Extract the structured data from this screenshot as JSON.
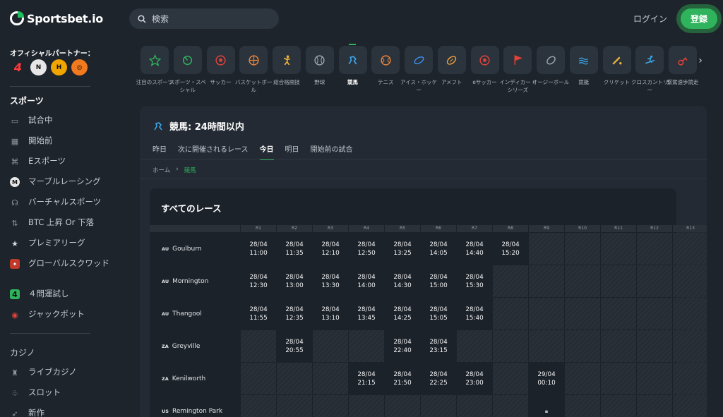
{
  "header": {
    "logo_text": "Sportsbet.io",
    "search_placeholder": "検索",
    "login": "ログイン",
    "register": "登録"
  },
  "sidebar": {
    "partner_label": "オフィシャルパートナー：",
    "sports_title": "スポーツ",
    "items": [
      {
        "label": "試合中",
        "icon": "monitor-icon"
      },
      {
        "label": "開始前",
        "icon": "calendar-icon"
      },
      {
        "label": "Eスポーツ",
        "icon": "gamepad-icon"
      },
      {
        "label": "マーブルレーシング",
        "icon": "marble-icon"
      },
      {
        "label": "バーチャルスポーツ",
        "icon": "headset-icon"
      },
      {
        "label": "BTC 上昇 Or 下落",
        "icon": "updown-icon"
      },
      {
        "label": "プレミアリーグ",
        "icon": "premier-icon"
      },
      {
        "label": "グローバルスクワッド",
        "icon": "squad-icon"
      },
      {
        "label": "４問運試し",
        "icon": "four-icon"
      },
      {
        "label": "ジャックポット",
        "icon": "jackpot-icon"
      }
    ],
    "casino_title": "カジノ",
    "casino_items": [
      {
        "label": "ライブカジノ",
        "icon": "dealer-icon"
      },
      {
        "label": "スロット",
        "icon": "slot-icon"
      },
      {
        "label": "新作",
        "icon": "rocket-icon"
      }
    ]
  },
  "sports": [
    {
      "label": "注目のスポーツ",
      "icon": "star-icon",
      "color": "#2fb35c"
    },
    {
      "label": "スポーツ・スペシャル",
      "icon": "special-icon",
      "color": "#2fb35c"
    },
    {
      "label": "サッカー",
      "icon": "soccer-icon",
      "color": "#e0423a"
    },
    {
      "label": "バスケットボール",
      "icon": "basketball-icon",
      "color": "#e9833a"
    },
    {
      "label": "総合格闘技",
      "icon": "mma-icon",
      "color": "#e9b23a"
    },
    {
      "label": "野球",
      "icon": "baseball-icon",
      "color": "#9aa2aa"
    },
    {
      "label": "競馬",
      "icon": "horse-icon",
      "color": "#3aa6e9",
      "active": true
    },
    {
      "label": "テニス",
      "icon": "tennis-icon",
      "color": "#e9833a"
    },
    {
      "label": "アイス・ホッケー",
      "icon": "hockey-icon",
      "color": "#3a8ee9"
    },
    {
      "label": "アメフト",
      "icon": "football-icon",
      "color": "#e9a03a"
    },
    {
      "label": "eサッカー",
      "icon": "esoccer-icon",
      "color": "#e0423a"
    },
    {
      "label": "インディカー・シリーズ",
      "icon": "flag-icon",
      "color": "#e0423a"
    },
    {
      "label": "オージーボール",
      "icon": "aussie-icon",
      "color": "#9aa2aa"
    },
    {
      "label": "競艇",
      "icon": "boat-icon",
      "color": "#3aa6e9"
    },
    {
      "label": "クリケット",
      "icon": "cricket-icon",
      "color": "#e9b23a"
    },
    {
      "label": "クロスカントリー",
      "icon": "ski-icon",
      "color": "#3aa6e9"
    },
    {
      "label": "繋駕速歩競走",
      "icon": "harness-icon",
      "color": "#e0423a"
    }
  ],
  "panel": {
    "title": "競馬: 24時間以内",
    "tabs": [
      "昨日",
      "次に開催されるレース",
      "今日",
      "明日",
      "開始前の試合"
    ],
    "active_tab": 2,
    "breadcrumb_home": "ホーム",
    "breadcrumb_current": "競馬",
    "races_title": "すべてのレース"
  },
  "race_grid": {
    "columns": [
      "R1",
      "R2",
      "R3",
      "R4",
      "R5",
      "R6",
      "R7",
      "R8",
      "R9",
      "R10",
      "R11",
      "R12",
      "R13"
    ],
    "rows": [
      {
        "cc": "AU",
        "name": "Goulburn",
        "cells": [
          [
            "28/04",
            "11:00"
          ],
          [
            "28/04",
            "11:35"
          ],
          [
            "28/04",
            "12:10"
          ],
          [
            "28/04",
            "12:50"
          ],
          [
            "28/04",
            "13:25"
          ],
          [
            "28/04",
            "14:05"
          ],
          [
            "28/04",
            "14:40"
          ],
          [
            "28/04",
            "15:20"
          ],
          null,
          null,
          null,
          null,
          null
        ]
      },
      {
        "cc": "AU",
        "name": "Mornington",
        "cells": [
          [
            "28/04",
            "12:30"
          ],
          [
            "28/04",
            "13:00"
          ],
          [
            "28/04",
            "13:30"
          ],
          [
            "28/04",
            "14:00"
          ],
          [
            "28/04",
            "14:30"
          ],
          [
            "28/04",
            "15:00"
          ],
          [
            "28/04",
            "15:30"
          ],
          null,
          null,
          null,
          null,
          null,
          null
        ]
      },
      {
        "cc": "AU",
        "name": "Thangool",
        "cells": [
          [
            "28/04",
            "11:55"
          ],
          [
            "28/04",
            "12:35"
          ],
          [
            "28/04",
            "13:10"
          ],
          [
            "28/04",
            "13:45"
          ],
          [
            "28/04",
            "14:25"
          ],
          [
            "28/04",
            "15:05"
          ],
          [
            "28/04",
            "15:40"
          ],
          null,
          null,
          null,
          null,
          null,
          null
        ]
      },
      {
        "cc": "ZA",
        "name": "Greyville",
        "cells": [
          null,
          [
            "28/04",
            "20:55"
          ],
          null,
          null,
          [
            "28/04",
            "22:40"
          ],
          [
            "28/04",
            "23:15"
          ],
          null,
          null,
          null,
          null,
          null,
          null,
          null
        ]
      },
      {
        "cc": "ZA",
        "name": "Kenilworth",
        "cells": [
          null,
          null,
          null,
          [
            "28/04",
            "21:15"
          ],
          [
            "28/04",
            "21:50"
          ],
          [
            "28/04",
            "22:25"
          ],
          [
            "28/04",
            "23:00"
          ],
          null,
          [
            "29/04",
            "00:10"
          ],
          null,
          null,
          null,
          null
        ]
      },
      {
        "cc": "US",
        "name": "Remington Park",
        "cells": [
          null,
          null,
          null,
          null,
          null,
          null,
          null,
          null,
          "lock",
          null,
          null,
          null,
          null
        ]
      }
    ]
  },
  "colors": {
    "accent": "#2fb35c",
    "background": "#1e242c",
    "panel": "#232a33"
  }
}
